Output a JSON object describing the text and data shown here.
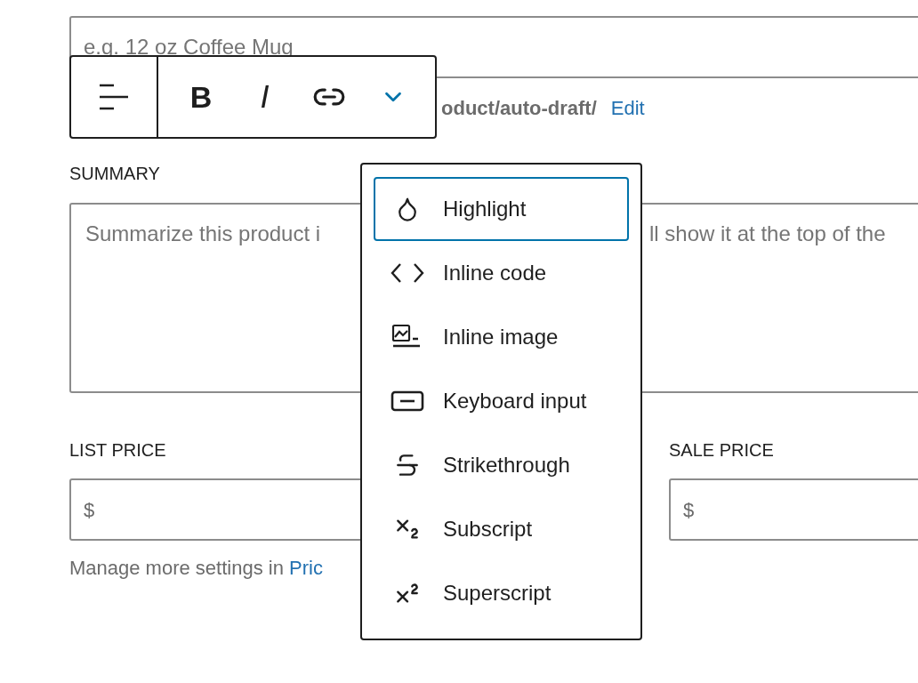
{
  "title_field": {
    "placeholder": "e.g. 12 oz Coffee Mug"
  },
  "permalink": {
    "path": "oduct/auto-draft/",
    "edit_link": "Edit"
  },
  "toolbar": {
    "buttons": [
      {
        "kind": "align"
      },
      {
        "kind": "bold",
        "label": "B"
      },
      {
        "kind": "italic",
        "label": "I"
      },
      {
        "kind": "link"
      },
      {
        "kind": "more",
        "expanded": true
      }
    ]
  },
  "summary": {
    "label": "SUMMARY",
    "placeholder_left": "Summarize this product i",
    "placeholder_right": "ll show it at the top of the"
  },
  "list_price": {
    "label": "LIST PRICE",
    "prefix": "$"
  },
  "sale_price": {
    "label": "SALE PRICE",
    "prefix": "$"
  },
  "help": {
    "text": "Manage more settings in ",
    "link": "Pric"
  },
  "menu": {
    "items": [
      {
        "kind": "highlight",
        "label": "Highlight",
        "selected": true
      },
      {
        "kind": "code",
        "label": "Inline code",
        "selected": false
      },
      {
        "kind": "image",
        "label": "Inline image",
        "selected": false
      },
      {
        "kind": "keyboard",
        "label": "Keyboard input",
        "selected": false
      },
      {
        "kind": "strikethrough",
        "label": "Strikethrough",
        "selected": false
      },
      {
        "kind": "subscript",
        "label": "Subscript",
        "selected": false
      },
      {
        "kind": "superscript",
        "label": "Superscript",
        "selected": false
      }
    ]
  }
}
